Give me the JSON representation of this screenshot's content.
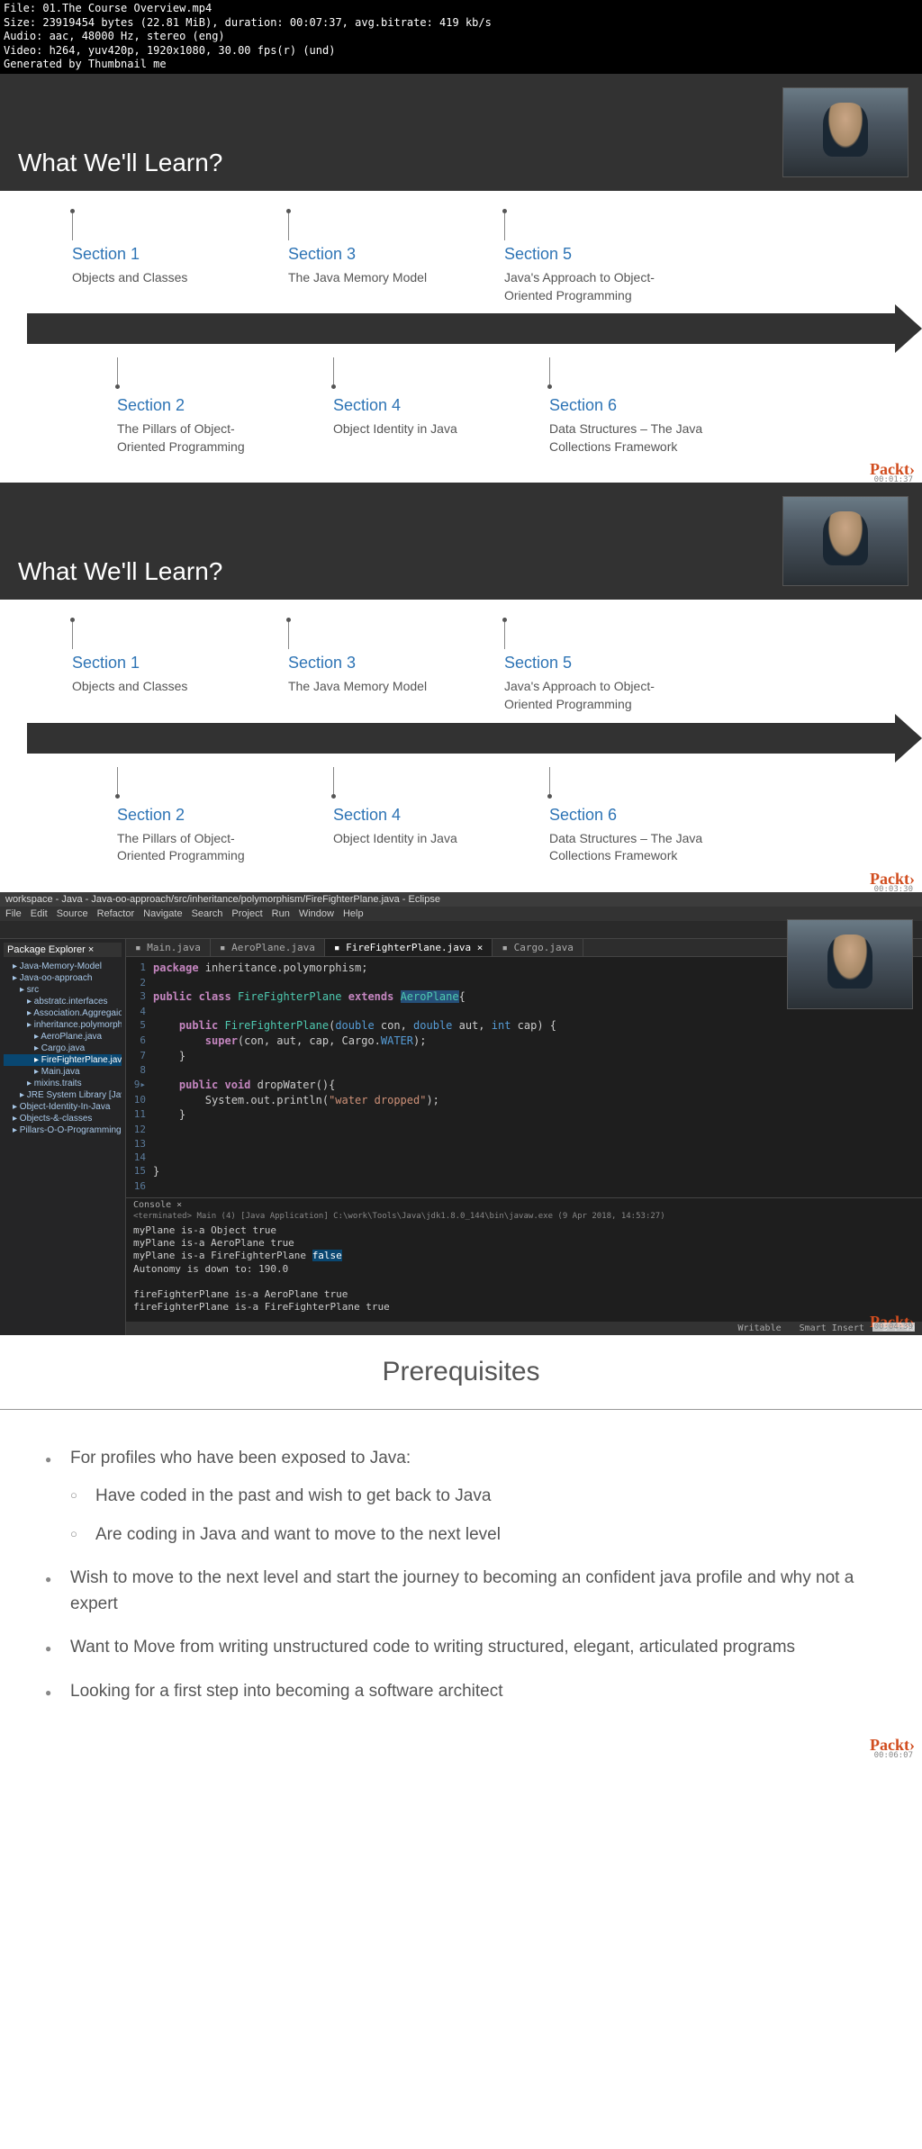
{
  "meta": {
    "file": "File: 01.The Course Overview.mp4",
    "size": "Size: 23919454 bytes (22.81 MiB), duration: 00:07:37, avg.bitrate: 419 kb/s",
    "audio": "Audio: aac, 48000 Hz, stereo (eng)",
    "video": "Video: h264, yuv420p, 1920x1080, 30.00 fps(r) (und)",
    "gen": "Generated by Thumbnail me"
  },
  "slide_title": "What We'll Learn?",
  "sections_top": [
    {
      "label": "Section 1",
      "desc": "Objects and Classes"
    },
    {
      "label": "Section 3",
      "desc": "The Java Memory Model"
    },
    {
      "label": "Section 5",
      "desc": "Java's Approach to Object-Oriented Programming"
    }
  ],
  "sections_bot": [
    {
      "label": "Section 2",
      "desc": "The Pillars of Object-Oriented Programming"
    },
    {
      "label": "Section 4",
      "desc": "Object Identity in Java"
    },
    {
      "label": "Section 6",
      "desc": "Data Structures – The Java Collections Framework"
    }
  ],
  "brand": "Packt›",
  "ts1": "00:01:37",
  "ts2": "00:03:30",
  "ts3": "00:04:39",
  "ts4": "00:06:07",
  "ide": {
    "title": "workspace - Java - Java-oo-approach/src/inheritance/polymorphism/FireFighterPlane.java - Eclipse",
    "menu": [
      "File",
      "Edit",
      "Source",
      "Refactor",
      "Navigate",
      "Search",
      "Project",
      "Run",
      "Window",
      "Help"
    ],
    "explorer_title": "Package Explorer ×",
    "tree": [
      {
        "t": "Java-Memory-Model",
        "c": ""
      },
      {
        "t": "Java-oo-approach",
        "c": ""
      },
      {
        "t": "src",
        "c": "ind1"
      },
      {
        "t": "abstratc.interfaces",
        "c": "ind2"
      },
      {
        "t": "Association.Aggregaion.C",
        "c": "ind2"
      },
      {
        "t": "inheritance.polymorphism",
        "c": "ind2"
      },
      {
        "t": "AeroPlane.java",
        "c": "ind3"
      },
      {
        "t": "Cargo.java",
        "c": "ind3"
      },
      {
        "t": "FireFighterPlane.java",
        "c": "ind3 sel"
      },
      {
        "t": "Main.java",
        "c": "ind3"
      },
      {
        "t": "mixins.traits",
        "c": "ind2"
      },
      {
        "t": "JRE System Library [JavaSE",
        "c": "ind1"
      },
      {
        "t": "Object-Identity-In-Java",
        "c": ""
      },
      {
        "t": "Objects-&-classes",
        "c": ""
      },
      {
        "t": "Pillars-O-O-Programming",
        "c": ""
      }
    ],
    "tabs": [
      {
        "l": "Main.java",
        "a": false
      },
      {
        "l": "AeroPlane.java",
        "a": false
      },
      {
        "l": "FireFighterPlane.java ×",
        "a": true
      },
      {
        "l": "Cargo.java",
        "a": false
      }
    ],
    "console_title": "Console ×",
    "console_sub": "<terminated> Main (4) [Java Application] C:\\work\\Tools\\Java\\jdk1.8.0_144\\bin\\javaw.exe (9 Apr 2018, 14:53:27)",
    "console_lines": [
      "myPlane is-a Object true",
      "myPlane is-a AeroPlane true"
    ],
    "console_hl_pre": "myPlane is-a FireFighterPlane ",
    "console_hl": "false",
    "console_lines2": [
      "Autonomy is down to: 190.0",
      "",
      "fireFighterPlane is-a AeroPlane true",
      "fireFighterPlane is-a FireFighterPlane true"
    ],
    "status": [
      "Writable",
      "Smart Insert",
      "3 : 40"
    ]
  },
  "prereq": {
    "title": "Prerequisites",
    "items": [
      {
        "text": "For profiles who have been exposed to Java:",
        "sub": [
          "Have coded in the past and wish to get back to Java",
          "Are coding in Java and want to move to the next level"
        ]
      },
      {
        "text": "Wish to move to the next level and start the journey to becoming an confident java profile and why not a expert"
      },
      {
        "text": "Want to Move from writing unstructured code to writing structured, elegant, articulated programs"
      },
      {
        "text": "Looking for a first step into becoming a software architect"
      }
    ]
  }
}
